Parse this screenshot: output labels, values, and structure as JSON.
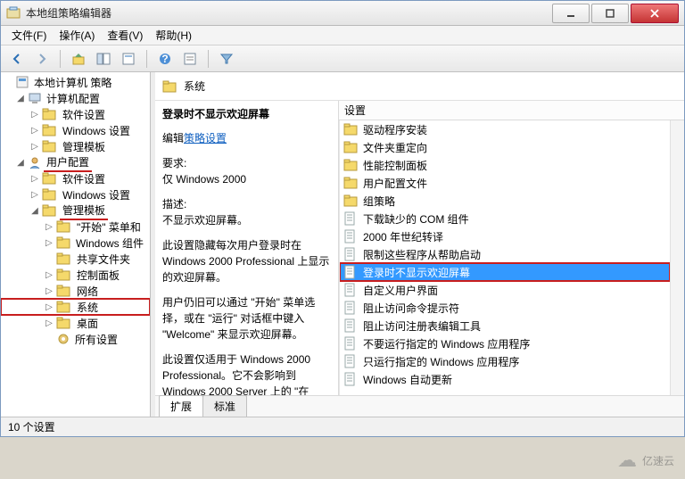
{
  "window": {
    "title": "本地组策略编辑器"
  },
  "menu": {
    "file": "文件(F)",
    "action": "操作(A)",
    "view": "查看(V)",
    "help": "帮助(H)"
  },
  "tree": {
    "root": "本地计算机 策略",
    "computer": "计算机配置",
    "c1": "软件设置",
    "c2": "Windows 设置",
    "c3": "管理模板",
    "user": "用户配置",
    "u1": "软件设置",
    "u2": "Windows 设置",
    "u3": "管理模板",
    "t1": "\"开始\" 菜单和",
    "t2": "Windows 组件",
    "t3": "共享文件夹",
    "t4": "控制面板",
    "t5": "网络",
    "t6": "系统",
    "t7": "桌面",
    "t8": "所有设置"
  },
  "right": {
    "header": "系统",
    "info_title": "登录时不显示欢迎屏幕",
    "edit_prefix": "编辑",
    "edit_link": "策略设置",
    "req_label": "要求:",
    "req_text": "仅 Windows 2000",
    "desc_label": "描述:",
    "p1": "不显示欢迎屏幕。",
    "p2": "此设置隐藏每次用户登录时在 Windows 2000 Professional 上显示的欢迎屏幕。",
    "p3": "用户仍旧可以通过 \"开始\" 菜单选择，或在 \"运行\" 对话框中键入 \"Welcome\" 来显示欢迎屏幕。",
    "p4": "此设置仅适用于 Windows 2000 Professional。它不会影响到 Windows 2000 Server 上的 \"在"
  },
  "list": {
    "col": "设置",
    "items": [
      {
        "t": "folder",
        "label": "驱动程序安装"
      },
      {
        "t": "folder",
        "label": "文件夹重定向"
      },
      {
        "t": "folder",
        "label": "性能控制面板"
      },
      {
        "t": "folder",
        "label": "用户配置文件"
      },
      {
        "t": "folder",
        "label": "组策略"
      },
      {
        "t": "setting",
        "label": "下载缺少的 COM 组件"
      },
      {
        "t": "setting",
        "label": "2000 年世纪转译"
      },
      {
        "t": "setting",
        "label": "限制这些程序从帮助启动"
      },
      {
        "t": "setting",
        "label": "登录时不显示欢迎屏幕",
        "sel": true,
        "red": true
      },
      {
        "t": "setting",
        "label": "自定义用户界面"
      },
      {
        "t": "setting",
        "label": "阻止访问命令提示符"
      },
      {
        "t": "setting",
        "label": "阻止访问注册表编辑工具"
      },
      {
        "t": "setting",
        "label": "不要运行指定的 Windows 应用程序"
      },
      {
        "t": "setting",
        "label": "只运行指定的 Windows 应用程序"
      },
      {
        "t": "setting",
        "label": "Windows 自动更新"
      }
    ]
  },
  "tabs": {
    "a": "扩展",
    "b": "标准"
  },
  "status": "10 个设置",
  "watermark": "亿速云"
}
